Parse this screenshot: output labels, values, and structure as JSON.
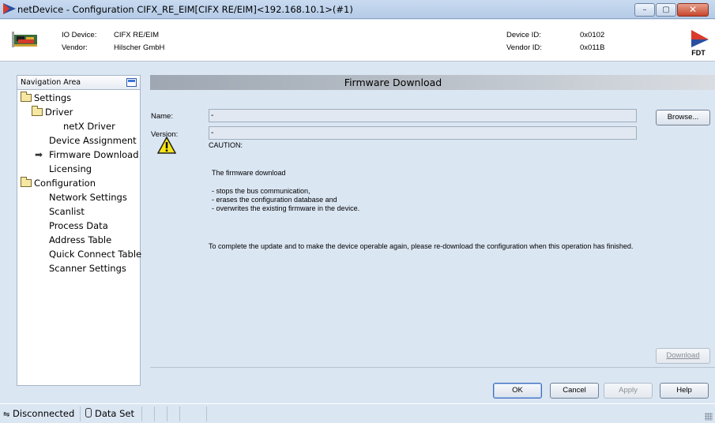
{
  "window": {
    "title": "netDevice - Configuration CIFX_RE_EIM[CIFX RE/EIM]<192.168.10.1>(#1)",
    "controls": {
      "minimize": "–",
      "maximize": "▢",
      "close": "✕"
    }
  },
  "header": {
    "io_device_label": "IO Device:",
    "io_device_value": "CIFX RE/EIM",
    "vendor_label": "Vendor:",
    "vendor_value": "Hilscher GmbH",
    "device_id_label": "Device ID:",
    "device_id_value": "0x0102",
    "vendor_id_label": "Vendor ID:",
    "vendor_id_value": "0x011B",
    "logo_text": "FDT"
  },
  "navigation": {
    "title": "Navigation Area",
    "items": [
      {
        "label": "Settings",
        "icon": "folder-icon"
      },
      {
        "label": "Driver",
        "icon": "folder-icon"
      },
      {
        "label": "netX Driver"
      },
      {
        "label": "Device Assignment"
      },
      {
        "label": "Firmware Download",
        "selected": true,
        "icon": "arrow-right-icon"
      },
      {
        "label": "Licensing"
      },
      {
        "label": "Configuration",
        "icon": "folder-icon"
      },
      {
        "label": "Network Settings"
      },
      {
        "label": "Scanlist"
      },
      {
        "label": "Process Data"
      },
      {
        "label": "Address Table"
      },
      {
        "label": "Quick Connect Table"
      },
      {
        "label": "Scanner Settings"
      }
    ]
  },
  "panel": {
    "title": "Firmware Download",
    "name_label": "Name:",
    "name_value": "-",
    "version_label": "Version:",
    "version_value": "-",
    "browse_label": "Browse...",
    "caution_title": "CAUTION:",
    "caution_intro": "The firmware download",
    "caution_items": [
      "- stops the bus communication,",
      "- erases the configuration database and",
      "- overwrites the existing firmware in the device."
    ],
    "caution_note": "To complete the update and to make the device operable again, please re-download the configuration when this operation has finished.",
    "download_label": "Download"
  },
  "buttons": {
    "ok": "OK",
    "cancel": "Cancel",
    "apply": "Apply",
    "help": "Help"
  },
  "status": {
    "connection": "Disconnected",
    "dataset": "Data Set"
  },
  "colors": {
    "accent": "#3b74d6",
    "warning": "#f6e419"
  }
}
